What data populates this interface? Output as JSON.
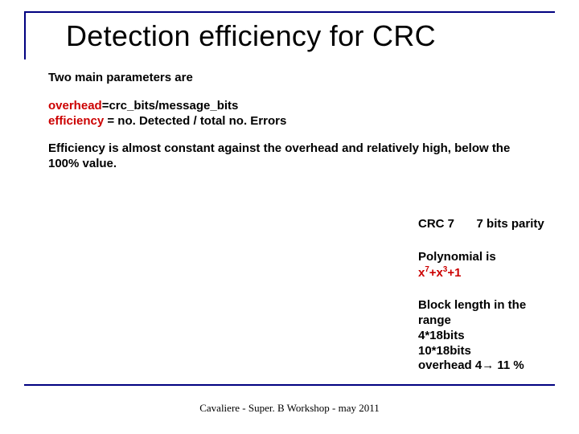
{
  "title": "Detection efficiency for CRC",
  "intro": "Two main parameters are",
  "defs": {
    "overhead_label": "overhead",
    "overhead_rest": "=crc_bits/message_bits",
    "efficiency_label": "efficiency",
    "efficiency_rest": " = no. Detected / total no. Errors"
  },
  "note": "Efficiency is almost constant against the overhead and relatively high, below the 100% value.",
  "right": {
    "crc_label": "CRC 7",
    "parity_label": "7 bits parity",
    "poly_intro": "Polynomial is",
    "poly_x": "x",
    "poly_e1": "7",
    "poly_plus1": "+",
    "poly_e2": "3",
    "poly_plus2": "+1",
    "block_l1": "Block length in the range",
    "block_l2": "4*18bits",
    "block_l3": "10*18bits",
    "overhead_line_pre": "overhead 4",
    "overhead_arrow": "→",
    "overhead_line_post": " 11 %"
  },
  "footer": "Cavaliere - Super. B Workshop - may 2011"
}
